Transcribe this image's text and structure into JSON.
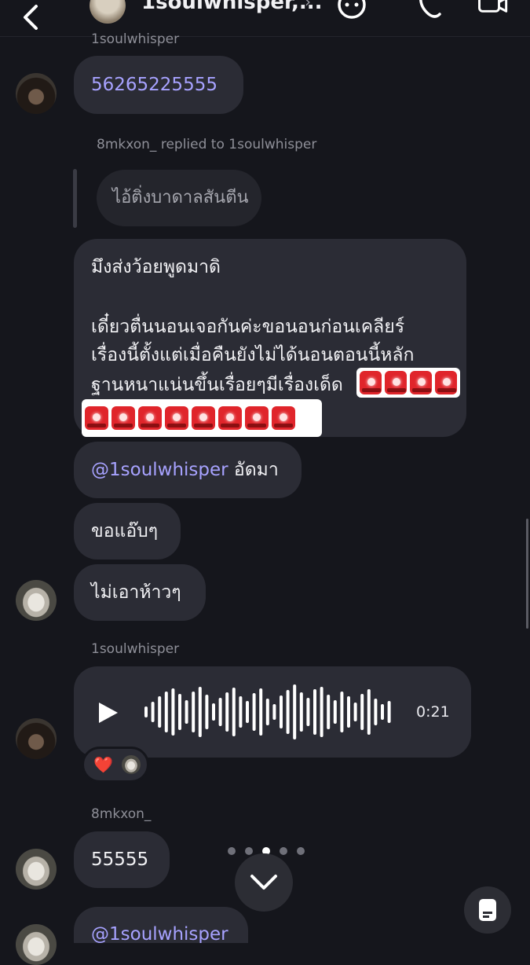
{
  "header": {
    "title": "1soulwhisper,...",
    "chevron": "›",
    "icons": [
      "back-chevron-icon",
      "sticker-face-icon",
      "phone-call-icon",
      "video-call-icon"
    ]
  },
  "messages": {
    "m1": {
      "sender": "1soulwhisper",
      "text": "56265225555"
    },
    "reply_meta": "8mkxon_ replied to 1soulwhisper",
    "quoted_text": "ไอ้ติ่งบาดาลสันตีน",
    "long": {
      "line1": "มึงส่งว้อยพูดมาดิ",
      "line2": "เดี๋ยวตื่นนอนเจอกันค่ะขอนอนก่อนเคลียร์",
      "line3": "เรื่องนี้ตั้งแต่เมื่อคืนยังไม่ได้นอนตอนนี้หลัก",
      "line4": "ฐานหนาแน่นขึ้นเรื่อยๆมีเรื่องเด็ด",
      "emoji": "rotating-light-emoji",
      "emoji_row1_count": 4,
      "emoji_row2_count": 8
    },
    "mention_msg": {
      "mention": "@1soulwhisper",
      "text": " อัดมา"
    },
    "m3": "ขอแอ๊บๆ",
    "m4": "ไม่เอาห้าวๆ",
    "voice": {
      "sender": "1soulwhisper",
      "duration": "0:21",
      "reaction": "❤️"
    },
    "m5": {
      "sender": "8mkxon_",
      "text": "55555"
    },
    "m6_partial": "@1soulwhisper"
  },
  "pager": {
    "dot_count": 5,
    "active_index": 2
  },
  "colors": {
    "background": "#15161c",
    "bubble": "#2b2c35",
    "mention": "#a7a2ff",
    "siren": "#e0252b"
  }
}
